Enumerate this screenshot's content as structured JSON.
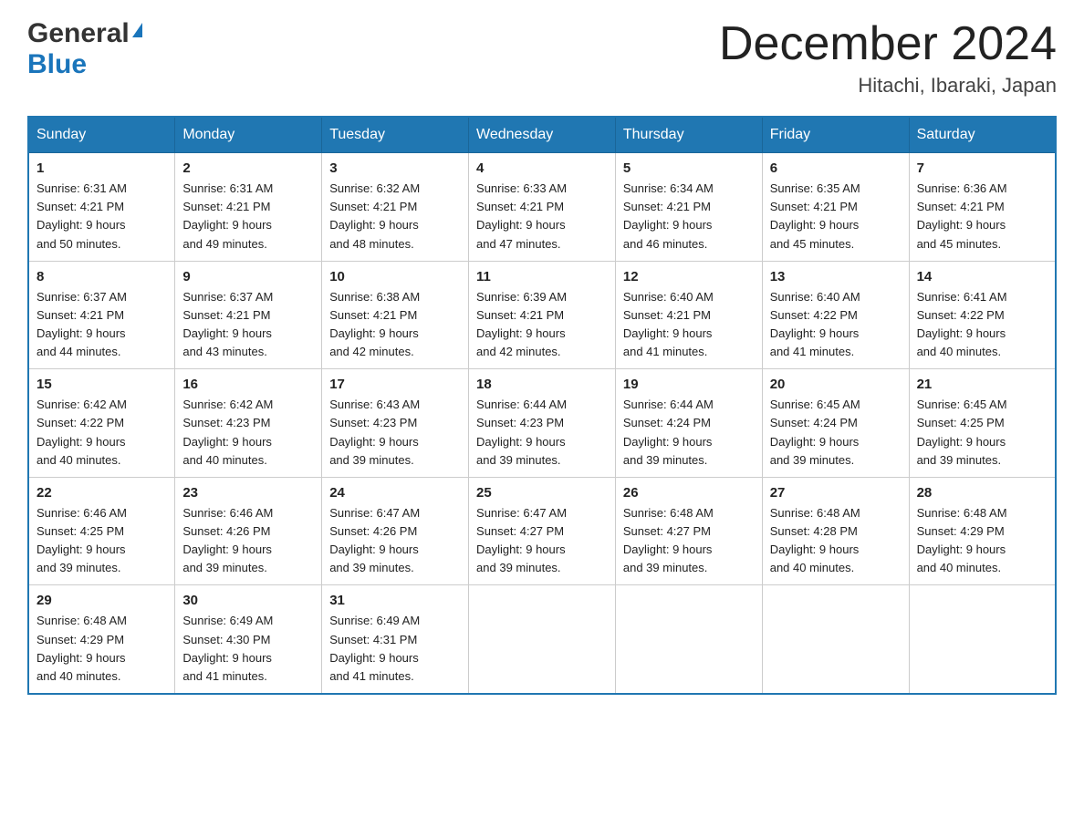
{
  "header": {
    "logo_general": "General",
    "logo_blue": "Blue",
    "month_title": "December 2024",
    "location": "Hitachi, Ibaraki, Japan"
  },
  "columns": [
    "Sunday",
    "Monday",
    "Tuesday",
    "Wednesday",
    "Thursday",
    "Friday",
    "Saturday"
  ],
  "weeks": [
    [
      {
        "day": "1",
        "sunrise": "6:31 AM",
        "sunset": "4:21 PM",
        "daylight": "9 hours and 50 minutes."
      },
      {
        "day": "2",
        "sunrise": "6:31 AM",
        "sunset": "4:21 PM",
        "daylight": "9 hours and 49 minutes."
      },
      {
        "day": "3",
        "sunrise": "6:32 AM",
        "sunset": "4:21 PM",
        "daylight": "9 hours and 48 minutes."
      },
      {
        "day": "4",
        "sunrise": "6:33 AM",
        "sunset": "4:21 PM",
        "daylight": "9 hours and 47 minutes."
      },
      {
        "day": "5",
        "sunrise": "6:34 AM",
        "sunset": "4:21 PM",
        "daylight": "9 hours and 46 minutes."
      },
      {
        "day": "6",
        "sunrise": "6:35 AM",
        "sunset": "4:21 PM",
        "daylight": "9 hours and 45 minutes."
      },
      {
        "day": "7",
        "sunrise": "6:36 AM",
        "sunset": "4:21 PM",
        "daylight": "9 hours and 45 minutes."
      }
    ],
    [
      {
        "day": "8",
        "sunrise": "6:37 AM",
        "sunset": "4:21 PM",
        "daylight": "9 hours and 44 minutes."
      },
      {
        "day": "9",
        "sunrise": "6:37 AM",
        "sunset": "4:21 PM",
        "daylight": "9 hours and 43 minutes."
      },
      {
        "day": "10",
        "sunrise": "6:38 AM",
        "sunset": "4:21 PM",
        "daylight": "9 hours and 42 minutes."
      },
      {
        "day": "11",
        "sunrise": "6:39 AM",
        "sunset": "4:21 PM",
        "daylight": "9 hours and 42 minutes."
      },
      {
        "day": "12",
        "sunrise": "6:40 AM",
        "sunset": "4:21 PM",
        "daylight": "9 hours and 41 minutes."
      },
      {
        "day": "13",
        "sunrise": "6:40 AM",
        "sunset": "4:22 PM",
        "daylight": "9 hours and 41 minutes."
      },
      {
        "day": "14",
        "sunrise": "6:41 AM",
        "sunset": "4:22 PM",
        "daylight": "9 hours and 40 minutes."
      }
    ],
    [
      {
        "day": "15",
        "sunrise": "6:42 AM",
        "sunset": "4:22 PM",
        "daylight": "9 hours and 40 minutes."
      },
      {
        "day": "16",
        "sunrise": "6:42 AM",
        "sunset": "4:23 PM",
        "daylight": "9 hours and 40 minutes."
      },
      {
        "day": "17",
        "sunrise": "6:43 AM",
        "sunset": "4:23 PM",
        "daylight": "9 hours and 39 minutes."
      },
      {
        "day": "18",
        "sunrise": "6:44 AM",
        "sunset": "4:23 PM",
        "daylight": "9 hours and 39 minutes."
      },
      {
        "day": "19",
        "sunrise": "6:44 AM",
        "sunset": "4:24 PM",
        "daylight": "9 hours and 39 minutes."
      },
      {
        "day": "20",
        "sunrise": "6:45 AM",
        "sunset": "4:24 PM",
        "daylight": "9 hours and 39 minutes."
      },
      {
        "day": "21",
        "sunrise": "6:45 AM",
        "sunset": "4:25 PM",
        "daylight": "9 hours and 39 minutes."
      }
    ],
    [
      {
        "day": "22",
        "sunrise": "6:46 AM",
        "sunset": "4:25 PM",
        "daylight": "9 hours and 39 minutes."
      },
      {
        "day": "23",
        "sunrise": "6:46 AM",
        "sunset": "4:26 PM",
        "daylight": "9 hours and 39 minutes."
      },
      {
        "day": "24",
        "sunrise": "6:47 AM",
        "sunset": "4:26 PM",
        "daylight": "9 hours and 39 minutes."
      },
      {
        "day": "25",
        "sunrise": "6:47 AM",
        "sunset": "4:27 PM",
        "daylight": "9 hours and 39 minutes."
      },
      {
        "day": "26",
        "sunrise": "6:48 AM",
        "sunset": "4:27 PM",
        "daylight": "9 hours and 39 minutes."
      },
      {
        "day": "27",
        "sunrise": "6:48 AM",
        "sunset": "4:28 PM",
        "daylight": "9 hours and 40 minutes."
      },
      {
        "day": "28",
        "sunrise": "6:48 AM",
        "sunset": "4:29 PM",
        "daylight": "9 hours and 40 minutes."
      }
    ],
    [
      {
        "day": "29",
        "sunrise": "6:48 AM",
        "sunset": "4:29 PM",
        "daylight": "9 hours and 40 minutes."
      },
      {
        "day": "30",
        "sunrise": "6:49 AM",
        "sunset": "4:30 PM",
        "daylight": "9 hours and 41 minutes."
      },
      {
        "day": "31",
        "sunrise": "6:49 AM",
        "sunset": "4:31 PM",
        "daylight": "9 hours and 41 minutes."
      },
      null,
      null,
      null,
      null
    ]
  ],
  "labels": {
    "sunrise": "Sunrise:",
    "sunset": "Sunset:",
    "daylight": "Daylight:"
  }
}
